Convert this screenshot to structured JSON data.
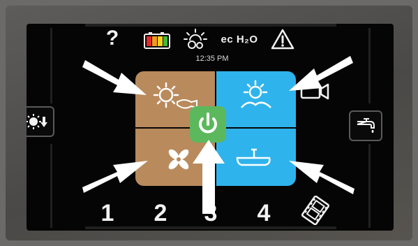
{
  "status_bar": {
    "help": "?",
    "eco_label": "ec H₂O",
    "time": "12:35 PM"
  },
  "zone_numbers": [
    "1",
    "2",
    "3",
    "4"
  ],
  "icons": {
    "help": "help-icon",
    "battery": "battery-icon",
    "sun_settings": "sun-settings-icon",
    "eco_water": "eco-water-icon",
    "warning": "warning-icon",
    "camera": "camera-icon",
    "sun_down": "sun-down-icon",
    "faucet": "faucet-icon",
    "film": "film-icon",
    "power": "power-icon"
  },
  "colors": {
    "tile_tan": "#b98a5c",
    "tile_blue": "#2fb3ec",
    "power_green": "#5cb85c",
    "battery_red": "#e02b2b",
    "battery_orange": "#f29a1f",
    "battery_yellow": "#f2d21f",
    "battery_green": "#3dbb3d"
  }
}
